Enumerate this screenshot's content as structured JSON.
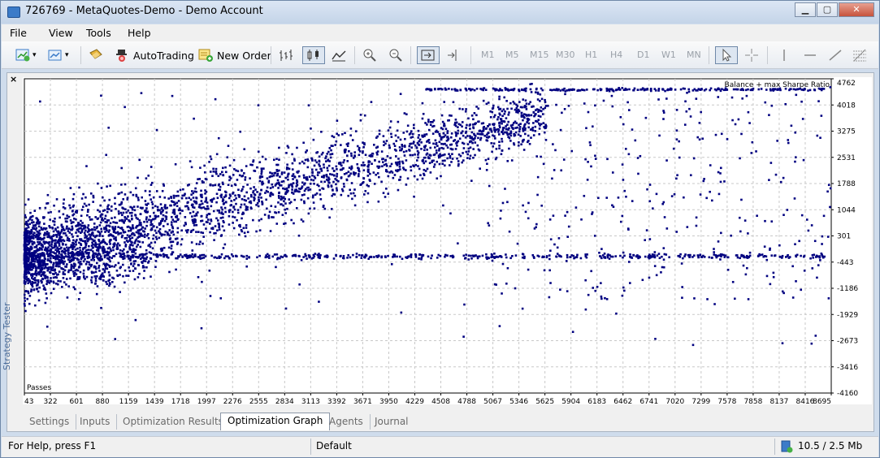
{
  "window": {
    "title": "726769 - MetaQuotes-Demo - Demo Account"
  },
  "menu": [
    "File",
    "View",
    "Tools",
    "Help"
  ],
  "toolbar": {
    "autotrading_label": "AutoTrading",
    "new_order_label": "New Order",
    "timeframes": [
      "M1",
      "M5",
      "M15",
      "M30",
      "H1",
      "H4",
      "D1",
      "W1",
      "MN"
    ]
  },
  "panel": {
    "side_title": "Strategy Tester",
    "close_glyph": "×"
  },
  "tabs": [
    "Settings",
    "Inputs",
    "Optimization Results",
    "Optimization Graph",
    "Agents",
    "Journal"
  ],
  "active_tab": "Optimization Graph",
  "status": {
    "help": "For Help, press F1",
    "profile": "Default",
    "traffic": "10.5 / 2.5 Mb"
  },
  "colors": {
    "points": "#000080",
    "grid": "#c8c8c8",
    "accent": "#3b7bc8"
  },
  "chart_data": {
    "type": "scatter",
    "title": "Balance + max Sharpe Ratio",
    "corner_label": "Passes",
    "x_ticks": [
      "43",
      "322",
      "601",
      "880",
      "1159",
      "1439",
      "1718",
      "1997",
      "2276",
      "2555",
      "2834",
      "3113",
      "3392",
      "3671",
      "3950",
      "4229",
      "4508",
      "4788",
      "5067",
      "5346",
      "5625",
      "5904",
      "6183",
      "6462",
      "6741",
      "7020",
      "7299",
      "7578",
      "7858",
      "8137",
      "8416",
      "8695"
    ],
    "y_ticks": [
      "4762",
      "4018",
      "3275",
      "2531",
      "1788",
      "1044",
      "301",
      "-443",
      "-1186",
      "-1929",
      "-2673",
      "-3416",
      "-4160"
    ],
    "xlim": [
      43,
      8695
    ],
    "ylim": [
      -4160,
      4762
    ],
    "grid": true,
    "points_note": "approximately 8700 optimization passes; balance vs pass number"
  }
}
